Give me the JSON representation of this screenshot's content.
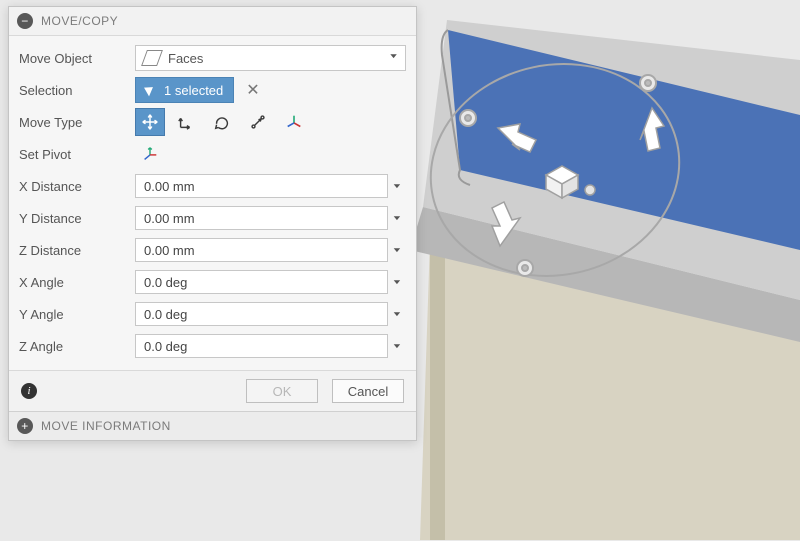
{
  "panel": {
    "title": "MOVE/COPY",
    "moveObject": {
      "label": "Move Object",
      "value": "Faces"
    },
    "selection": {
      "label": "Selection",
      "chip": "1 selected"
    },
    "moveType": {
      "label": "Move Type",
      "options": [
        "free-move",
        "translate",
        "rotate",
        "point-to-point",
        "axis-align"
      ],
      "active": 0
    },
    "setPivot": {
      "label": "Set Pivot"
    },
    "fields": [
      {
        "label": "X Distance",
        "value": "0.00 mm"
      },
      {
        "label": "Y Distance",
        "value": "0.00 mm"
      },
      {
        "label": "Z Distance",
        "value": "0.00 mm"
      },
      {
        "label": "X Angle",
        "value": "0.0 deg"
      },
      {
        "label": "Y Angle",
        "value": "0.0 deg"
      },
      {
        "label": "Z Angle",
        "value": "0.0 deg"
      }
    ],
    "buttons": {
      "ok": "OK",
      "cancel": "Cancel"
    },
    "sub": "MOVE INFORMATION"
  },
  "colors": {
    "accent": "#5a95c9",
    "face": "#4b72b6"
  }
}
